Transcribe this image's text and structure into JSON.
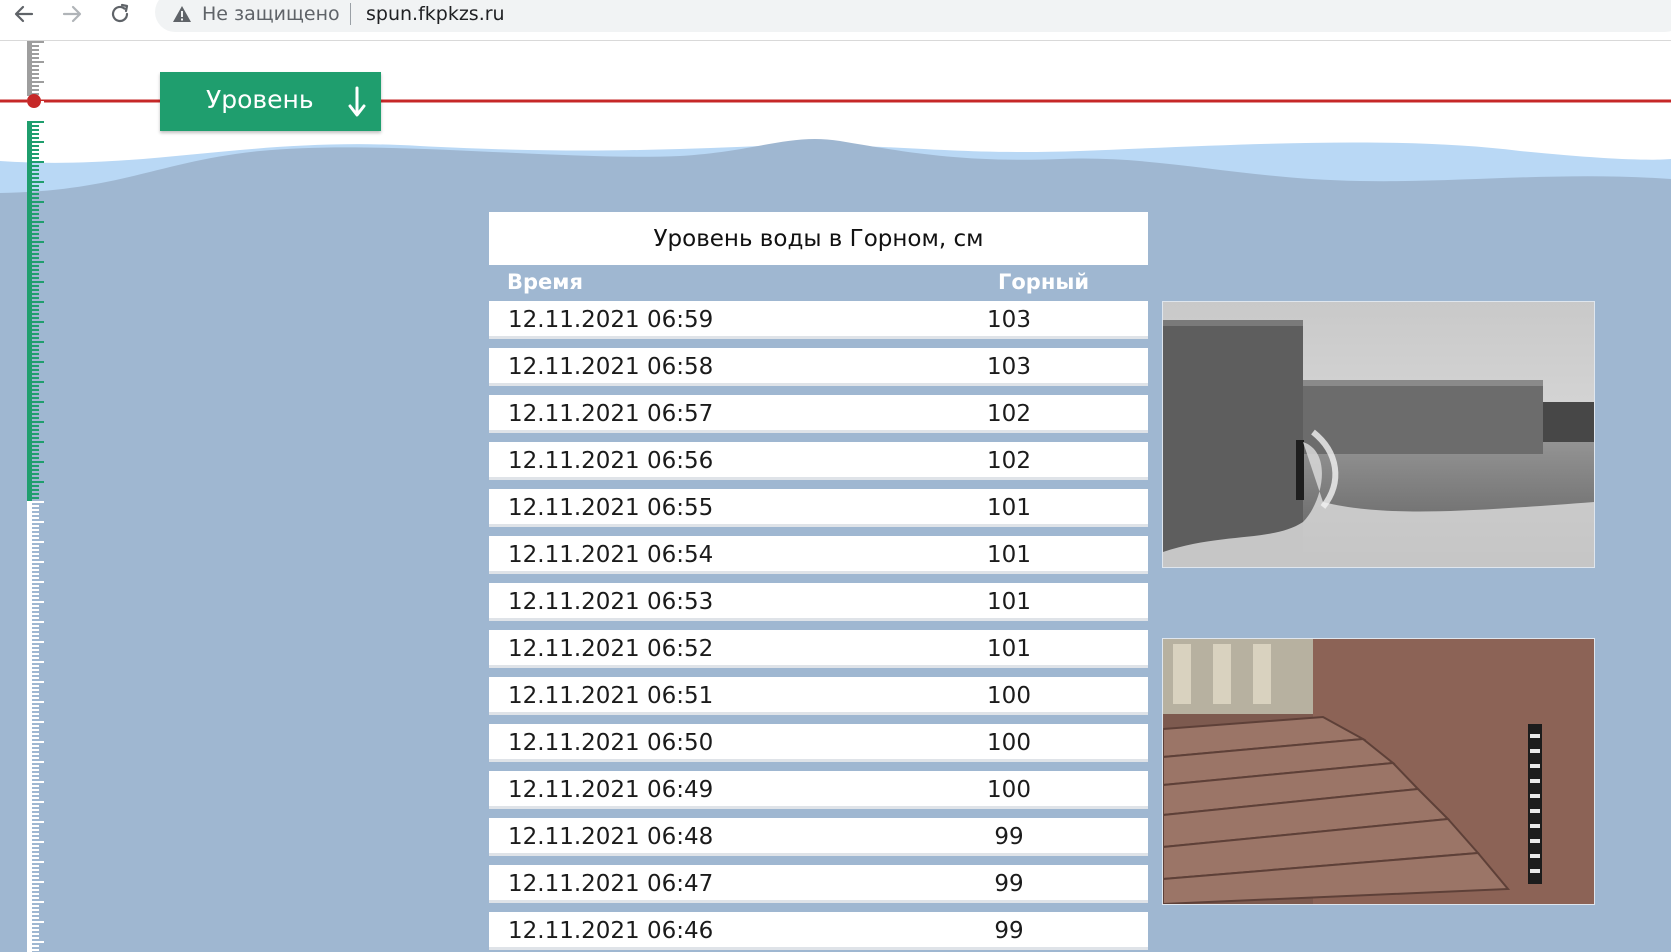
{
  "browser": {
    "security_text": "Не защищено",
    "url": "spun.fkpkzs.ru"
  },
  "level_button": {
    "label": "Уровень"
  },
  "table": {
    "title": "Уровень воды в Горном, см",
    "headers": {
      "time": "Время",
      "value": "Горный"
    },
    "rows": [
      {
        "time": "12.11.2021 06:59",
        "value": "103"
      },
      {
        "time": "12.11.2021 06:58",
        "value": "103"
      },
      {
        "time": "12.11.2021 06:57",
        "value": "102"
      },
      {
        "time": "12.11.2021 06:56",
        "value": "102"
      },
      {
        "time": "12.11.2021 06:55",
        "value": "101"
      },
      {
        "time": "12.11.2021 06:54",
        "value": "101"
      },
      {
        "time": "12.11.2021 06:53",
        "value": "101"
      },
      {
        "time": "12.11.2021 06:52",
        "value": "101"
      },
      {
        "time": "12.11.2021 06:51",
        "value": "100"
      },
      {
        "time": "12.11.2021 06:50",
        "value": "100"
      },
      {
        "time": "12.11.2021 06:49",
        "value": "100"
      },
      {
        "time": "12.11.2021 06:48",
        "value": "99"
      },
      {
        "time": "12.11.2021 06:47",
        "value": "99"
      },
      {
        "time": "12.11.2021 06:46",
        "value": "99"
      }
    ]
  },
  "colors": {
    "page_background": "#9fb7d1",
    "button_green": "#1f9e6e",
    "level_line_red": "#c62828",
    "wave_light": "#b9d8f5"
  },
  "icons": {
    "back": "back-arrow-icon",
    "forward": "forward-arrow-icon",
    "reload": "reload-icon",
    "warning": "warning-icon",
    "down_arrow": "down-arrow-icon"
  }
}
